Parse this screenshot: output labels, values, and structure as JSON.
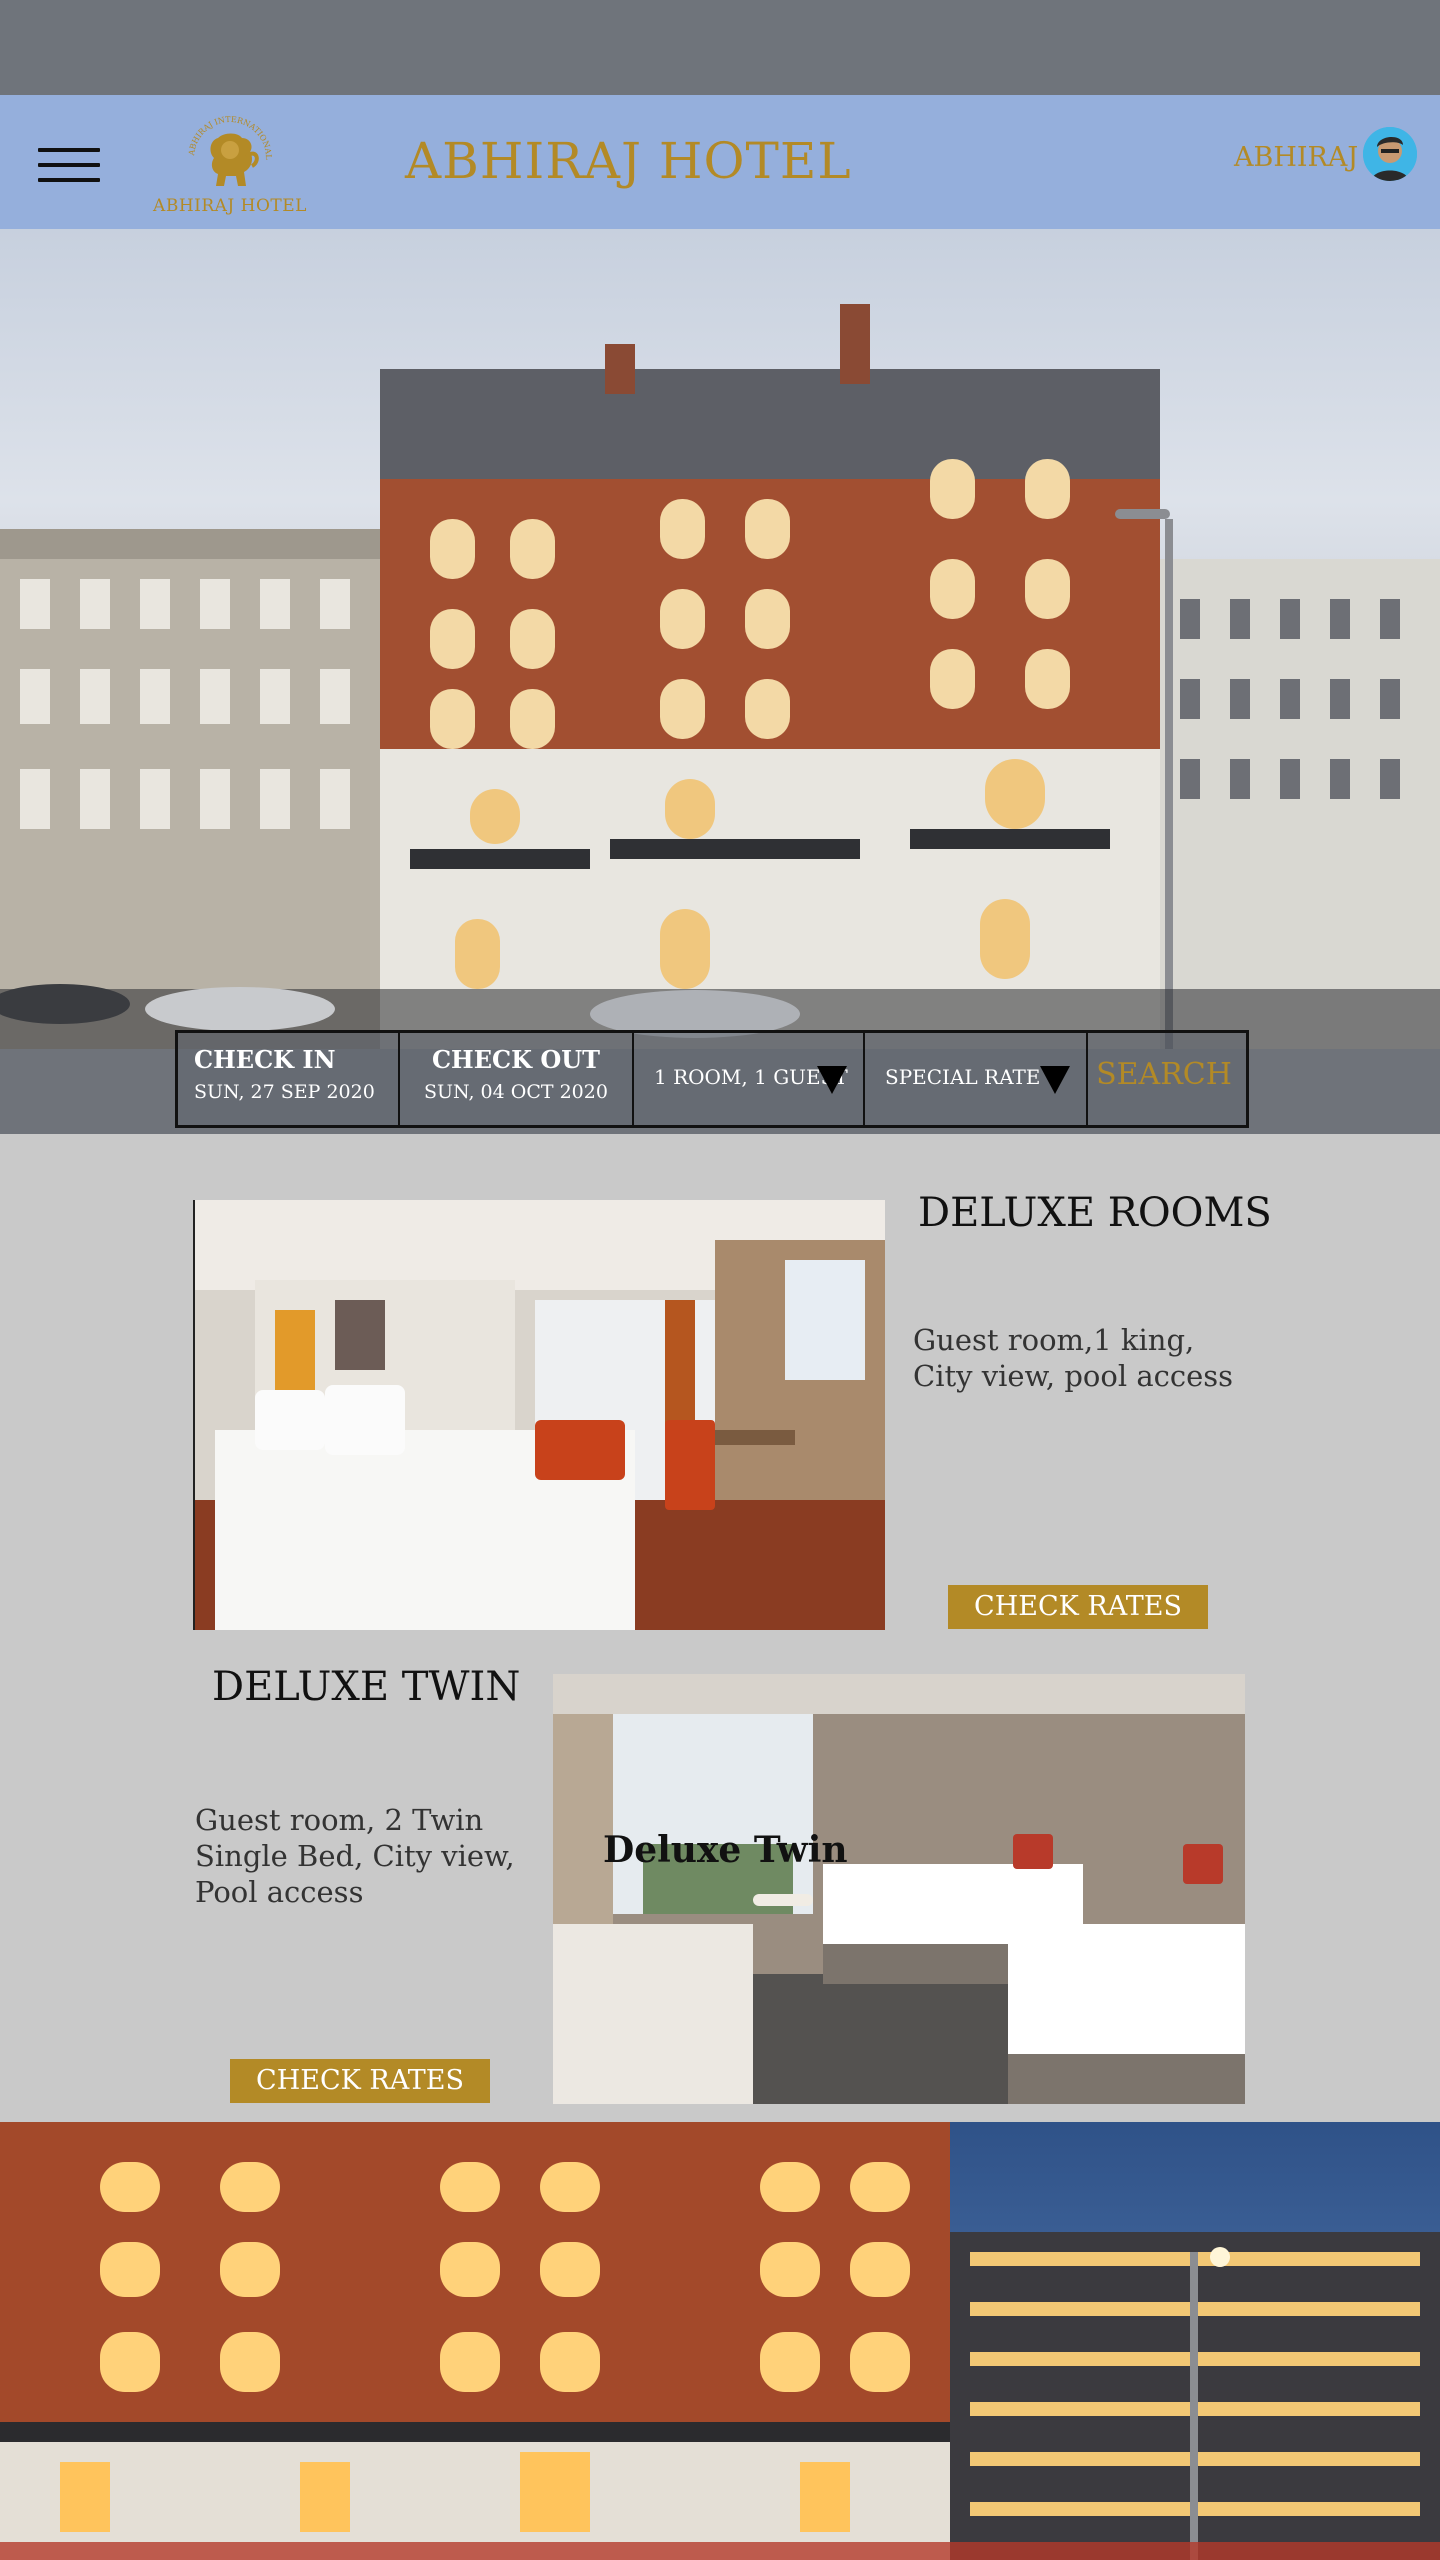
{
  "header": {
    "hotel_title": "ABHIRAJ HOTEL",
    "logo_text": "ABHIRAJ HOTEL",
    "logo_ring_text": "ABHIRAJ INTERNATIONAL HOTEL",
    "user_name": "ABHIRAJ"
  },
  "booking": {
    "check_in_label": "CHECK IN",
    "check_in_value": "SUN, 27 SEP 2020",
    "check_out_label": "CHECK OUT",
    "check_out_value": "SUN, 04  OCT 2020",
    "guests_value": "1 ROOM, 1 GUEST",
    "rate_value": "SPECIAL RATE",
    "search_label": "SEARCH"
  },
  "rooms": [
    {
      "title": "DELUXE ROOMS",
      "desc_line1": "Guest room,1 king,",
      "desc_line2": "City view, pool access",
      "button": "CHECK RATES"
    },
    {
      "title": "DELUXE TWIN",
      "desc_line1": "Guest room, 2 Twin",
      "desc_line2": "Single Bed, City view,",
      "desc_line3": "Pool access",
      "image_label": "Deluxe Twin",
      "button": "CHECK RATES"
    }
  ],
  "colors": {
    "accent_gold": "#b38a26",
    "header_blue": "#95afdc",
    "status_bar": "#6f747b",
    "page_bg": "#c9c9c9"
  },
  "icons": [
    "hamburger-menu-icon",
    "lion-logo-icon",
    "user-avatar",
    "dropdown-arrow-icon"
  ]
}
